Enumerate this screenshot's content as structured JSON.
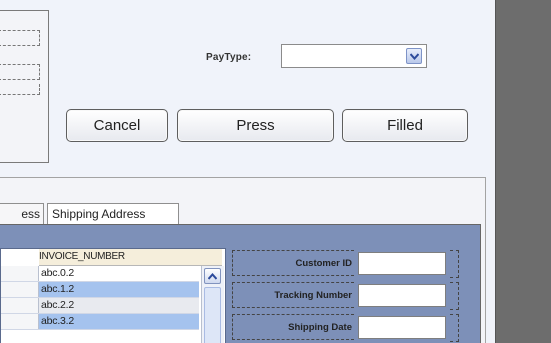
{
  "header": {
    "paytype_label": "PayType:",
    "paytype_value": ""
  },
  "actions": {
    "cancel_label": "Cancel",
    "press_label": "Press",
    "filled_label": "Filled"
  },
  "tabs": [
    {
      "label": "ess"
    },
    {
      "label": "Shipping Address"
    }
  ],
  "invoice_table": {
    "column_header": "INVOICE_NUMBER",
    "rows": [
      {
        "value": "abc.0.2"
      },
      {
        "value": "abc.1.2"
      },
      {
        "value": "abc.2.2"
      },
      {
        "value": "abc.3.2"
      }
    ]
  },
  "form": {
    "customer_id_label": "Customer ID",
    "customer_id_value": "",
    "tracking_number_label": "Tracking Number",
    "tracking_number_value": "",
    "shipping_date_label": "Shipping Date",
    "shipping_date_value": ""
  },
  "colors": {
    "panel_blue": "#7d90b8",
    "selected_row": "#a5c3ee",
    "header_bg": "#f5eedb"
  }
}
